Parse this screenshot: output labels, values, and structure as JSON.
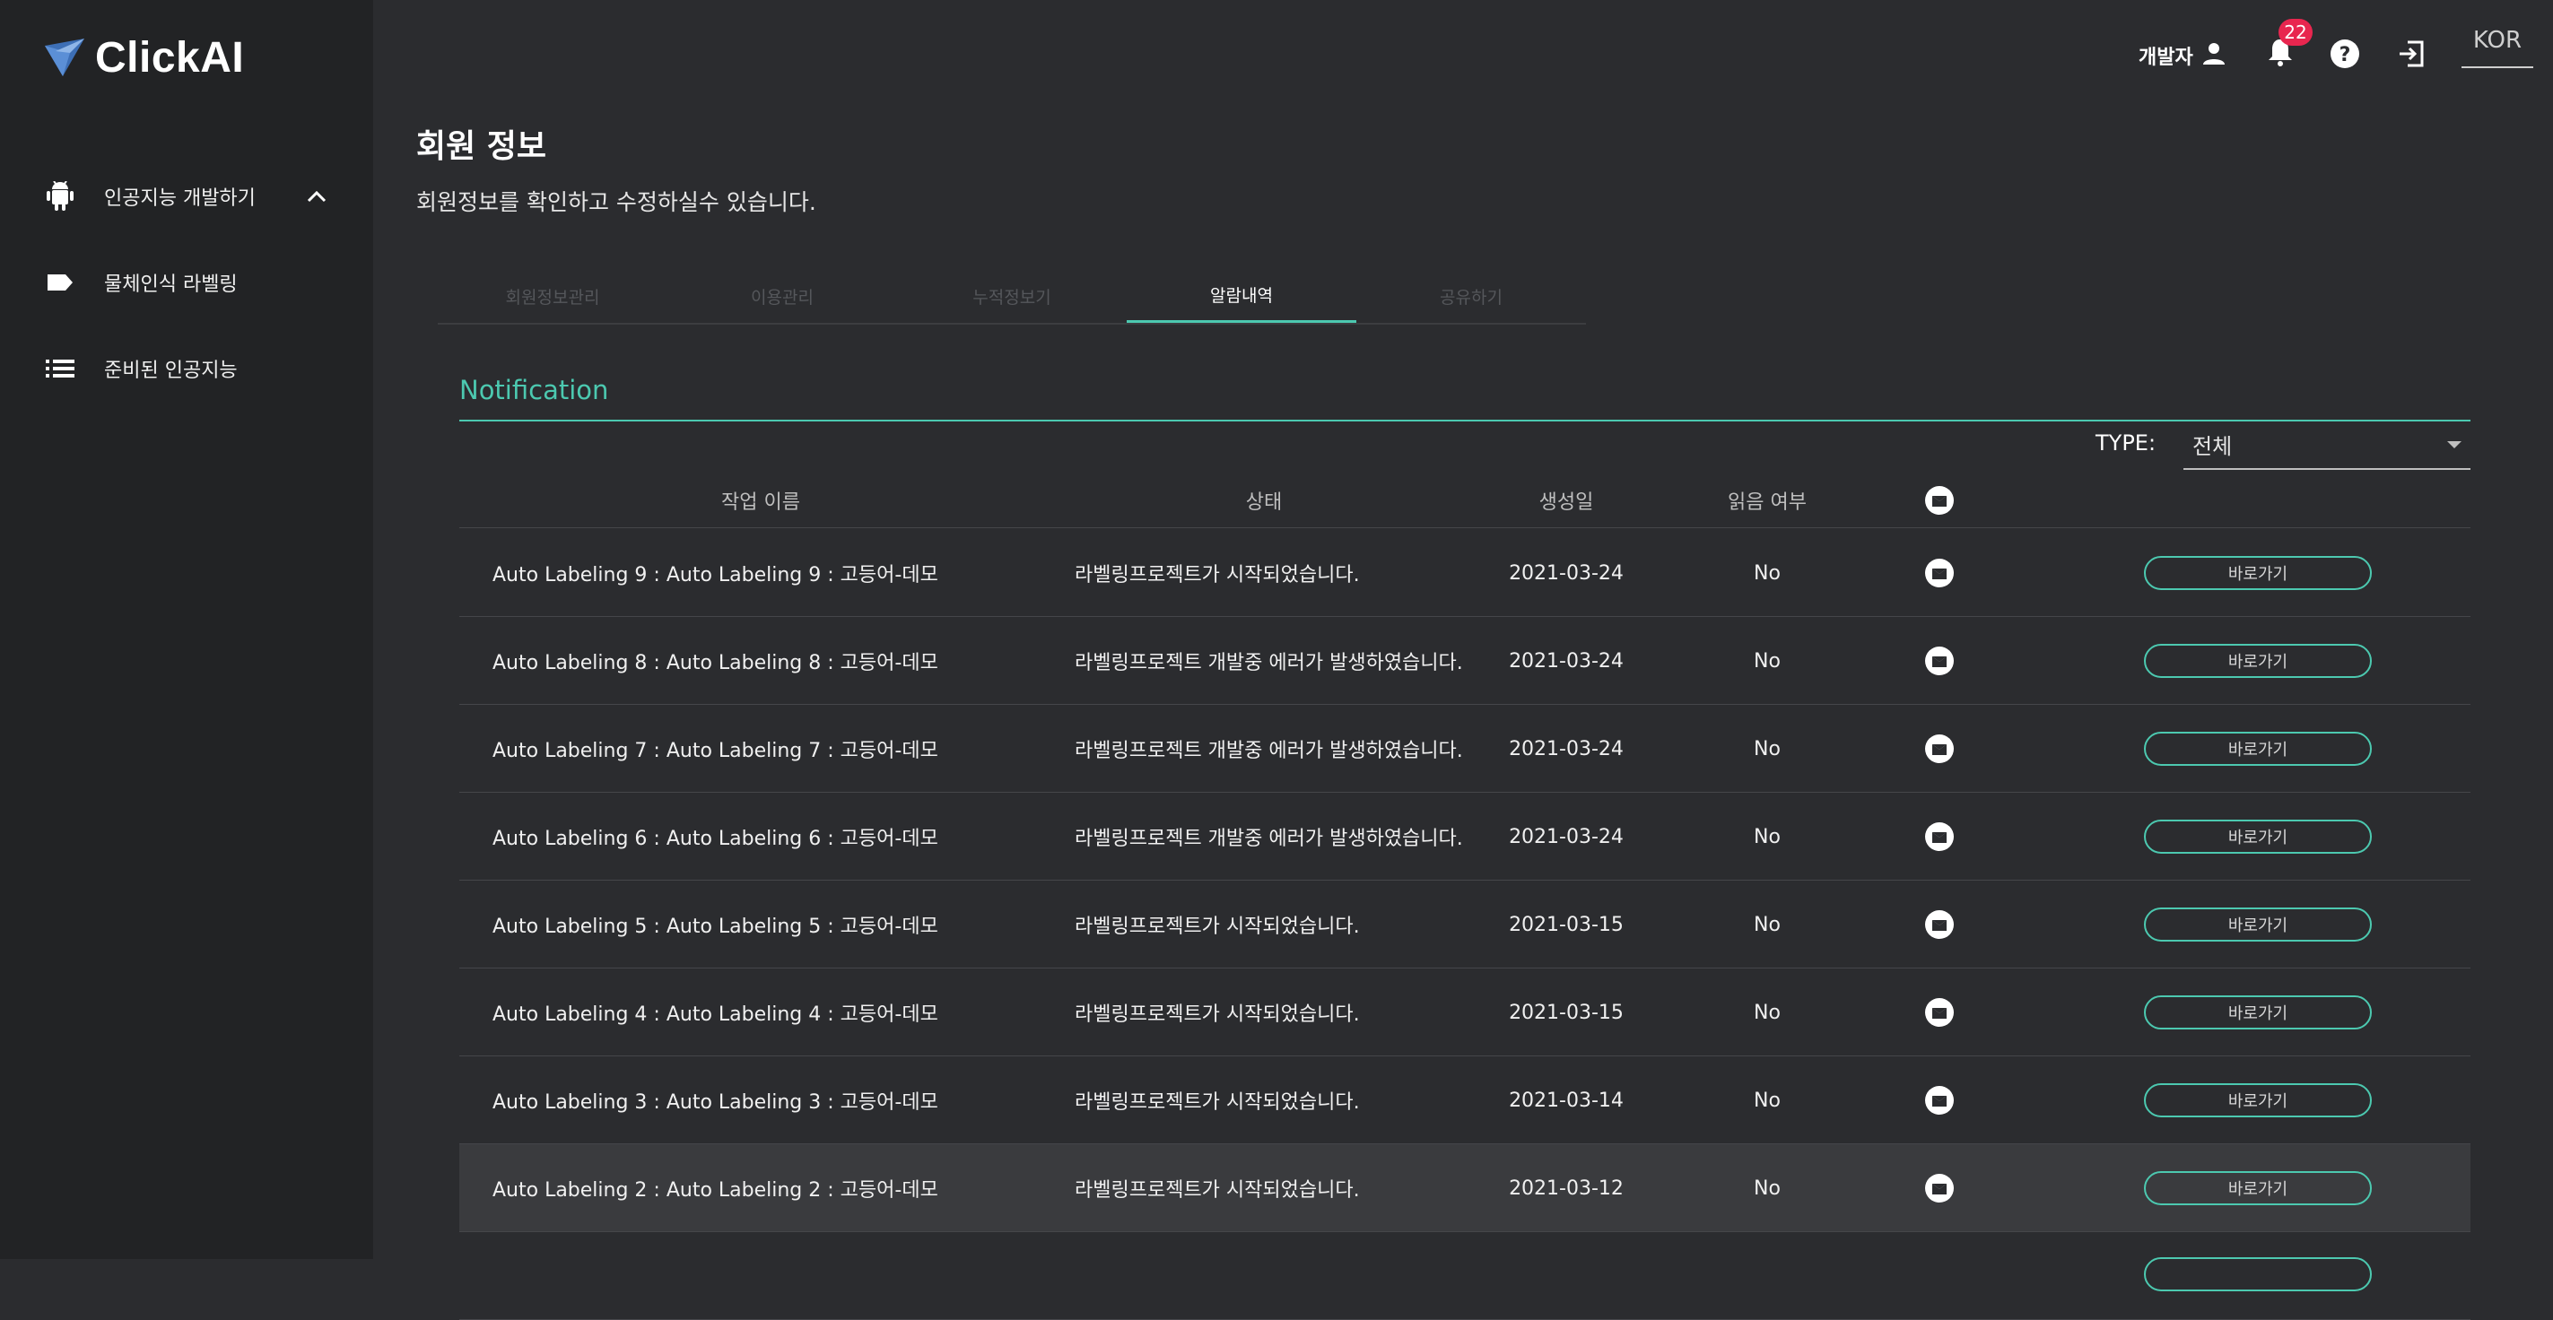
{
  "app": {
    "logo_text": "ClickAI"
  },
  "sidebar": {
    "items": [
      {
        "label": "인공지능 개발하기",
        "icon": "android-icon",
        "expanded": true
      },
      {
        "label": "물체인식 라벨링",
        "icon": "label-tag-icon"
      },
      {
        "label": "준비된 인공지능",
        "icon": "list-icon"
      }
    ]
  },
  "header": {
    "user_role": "개발자",
    "notification_count": "22",
    "language": "KOR"
  },
  "page": {
    "title": "회원 정보",
    "subtitle": "회원정보를 확인하고 수정하실수 있습니다."
  },
  "tabs": [
    {
      "label": "회원정보관리",
      "active": false
    },
    {
      "label": "이용관리",
      "active": false
    },
    {
      "label": "누적정보기",
      "active": false
    },
    {
      "label": "알람내역",
      "active": true
    },
    {
      "label": "공유하기",
      "active": false
    }
  ],
  "notification": {
    "section_title": "Notification",
    "type_label": "TYPE:",
    "type_value": "전체",
    "columns": {
      "name": "작업 이름",
      "status": "상태",
      "created": "생성일",
      "read": "읽음 여부"
    },
    "button_label": "바로가기",
    "rows": [
      {
        "name": "Auto Labeling 9 : Auto Labeling 9 : 고등어-데모",
        "status": "라벨링프로젝트가 시작되었습니다.",
        "created": "2021-03-24",
        "read": "No"
      },
      {
        "name": "Auto Labeling 8 : Auto Labeling 8 : 고등어-데모",
        "status": "라벨링프로젝트 개발중 에러가 발생하였습니다.",
        "created": "2021-03-24",
        "read": "No"
      },
      {
        "name": "Auto Labeling 7 : Auto Labeling 7 : 고등어-데모",
        "status": "라벨링프로젝트 개발중 에러가 발생하였습니다.",
        "created": "2021-03-24",
        "read": "No"
      },
      {
        "name": "Auto Labeling 6 : Auto Labeling 6 : 고등어-데모",
        "status": "라벨링프로젝트 개발중 에러가 발생하였습니다.",
        "created": "2021-03-24",
        "read": "No"
      },
      {
        "name": "Auto Labeling 5 : Auto Labeling 5 : 고등어-데모",
        "status": "라벨링프로젝트가 시작되었습니다.",
        "created": "2021-03-15",
        "read": "No"
      },
      {
        "name": "Auto Labeling 4 : Auto Labeling 4 : 고등어-데모",
        "status": "라벨링프로젝트가 시작되었습니다.",
        "created": "2021-03-15",
        "read": "No"
      },
      {
        "name": "Auto Labeling 3 : Auto Labeling 3 : 고등어-데모",
        "status": "라벨링프로젝트가 시작되었습니다.",
        "created": "2021-03-14",
        "read": "No"
      },
      {
        "name": "Auto Labeling 2 : Auto Labeling 2 : 고등어-데모",
        "status": "라벨링프로젝트가 시작되었습니다.",
        "created": "2021-03-12",
        "read": "No"
      }
    ]
  },
  "colors": {
    "accent": "#4cc9b0",
    "badge": "#e8264f",
    "background": "#2b2c2f",
    "sidebar": "#222325"
  }
}
